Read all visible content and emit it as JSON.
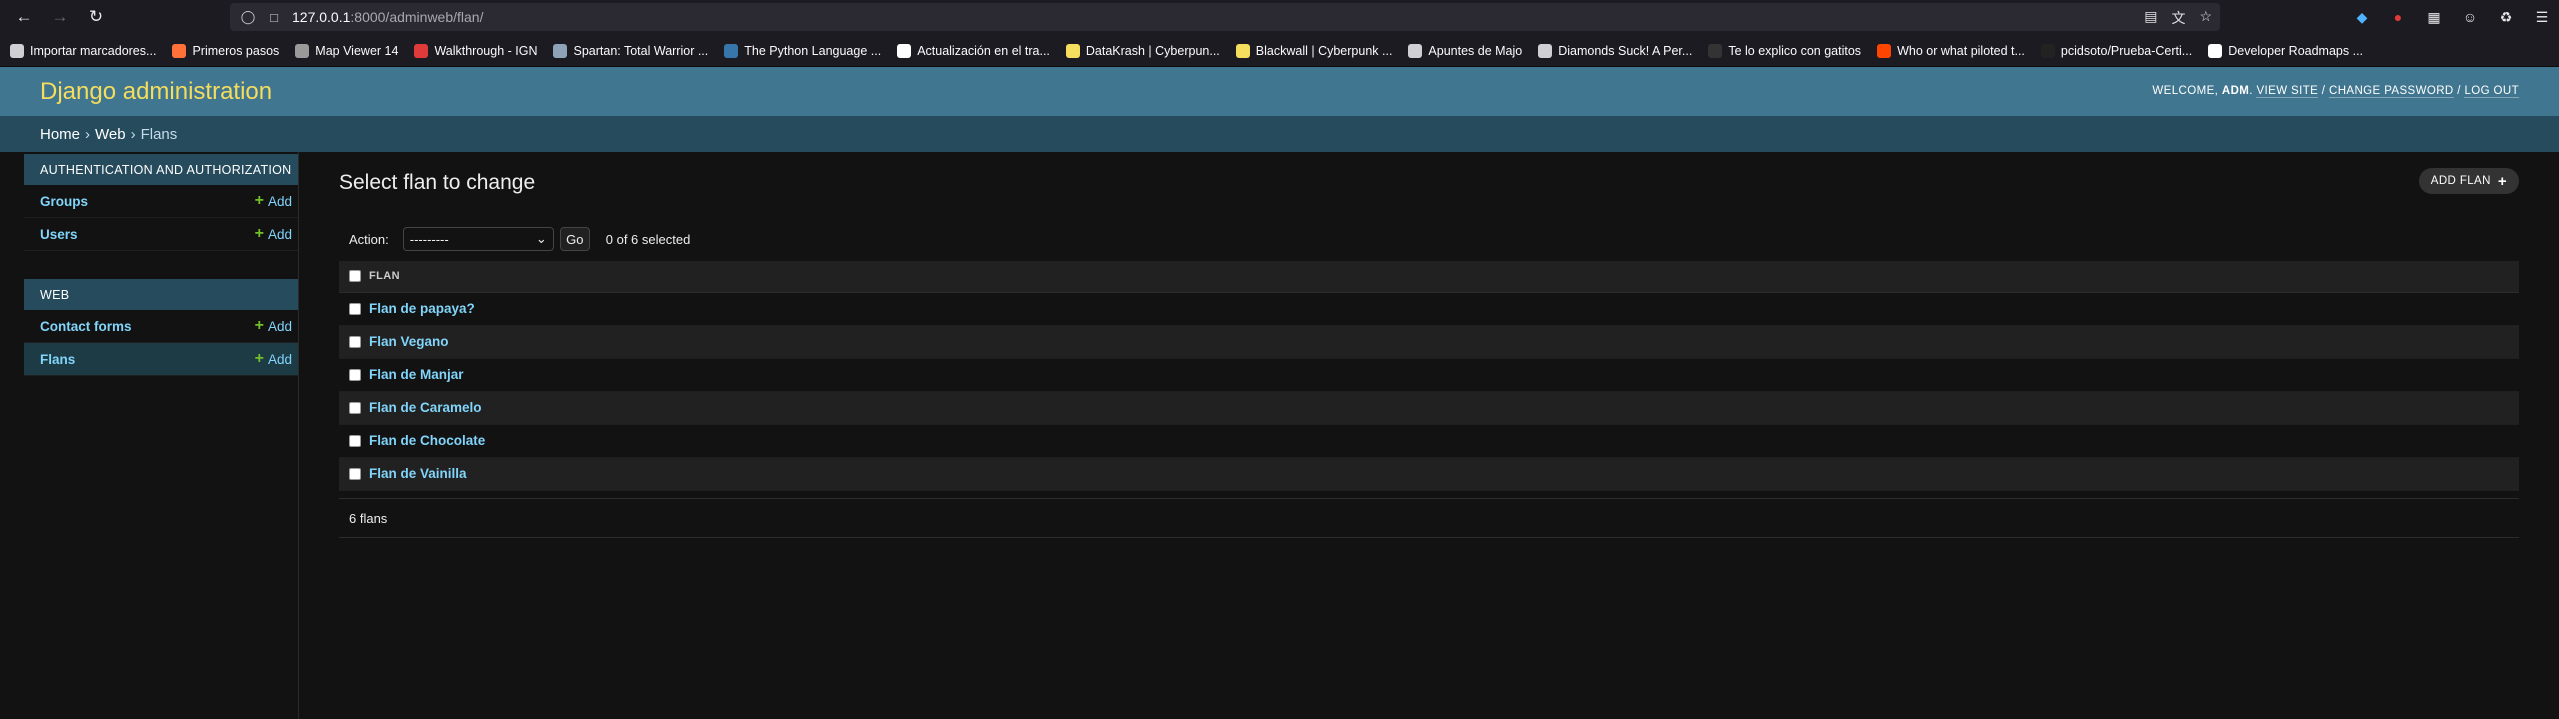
{
  "browser": {
    "url_host": "127.0.0.1",
    "url_rest": ":8000/adminweb/flan/",
    "bookmarks": [
      {
        "label": "Importar marcadores...",
        "color": "#cfcfd4"
      },
      {
        "label": "Primeros pasos",
        "color": "#ff7139"
      },
      {
        "label": "Map Viewer 14",
        "color": "#9a9a9a"
      },
      {
        "label": "Walkthrough - IGN",
        "color": "#e03b3b"
      },
      {
        "label": "Spartan: Total Warrior ...",
        "color": "#8fa3b8"
      },
      {
        "label": "The Python Language ...",
        "color": "#3776ab"
      },
      {
        "label": "Actualización en el tra...",
        "color": "#ffffff"
      },
      {
        "label": "DataKrash | Cyberpun...",
        "color": "#f5dd5d"
      },
      {
        "label": "Blackwall | Cyberpunk ...",
        "color": "#f5dd5d"
      },
      {
        "label": "Apuntes de Majo",
        "color": "#cfcfd4"
      },
      {
        "label": "Diamonds Suck! A Per...",
        "color": "#cfcfd4"
      },
      {
        "label": "Te lo explico con gatitos",
        "color": "#333333"
      },
      {
        "label": "Who or what piloted t...",
        "color": "#ff4500"
      },
      {
        "label": "pcidsoto/Prueba-Certi...",
        "color": "#222222"
      },
      {
        "label": "Developer Roadmaps ...",
        "color": "#ffffff"
      }
    ]
  },
  "header": {
    "branding": "Django administration",
    "welcome": "WELCOME,",
    "user": "ADM",
    "view_site": "VIEW SITE",
    "change_password": "CHANGE PASSWORD",
    "log_out": "LOG OUT"
  },
  "breadcrumbs": [
    "Home",
    "Web",
    "Flans"
  ],
  "sidebar": {
    "modules": [
      {
        "caption": "AUTHENTICATION AND AUTHORIZATION",
        "models": [
          {
            "name": "Groups",
            "add": "Add"
          },
          {
            "name": "Users",
            "add": "Add"
          }
        ]
      },
      {
        "caption": "WEB",
        "models": [
          {
            "name": "Contact forms",
            "add": "Add"
          },
          {
            "name": "Flans",
            "add": "Add"
          }
        ]
      }
    ]
  },
  "content": {
    "title": "Select flan to change",
    "add_button": "ADD FLAN",
    "action_label": "Action:",
    "action_selected": "---------",
    "go_label": "Go",
    "counter": "0 of 6 selected",
    "column_header": "FLAN",
    "rows": [
      "Flan de papaya?",
      "Flan Vegano",
      "Flan de Manjar",
      "Flan de Caramelo",
      "Flan de Chocolate",
      "Flan de Vainilla"
    ],
    "paginator": "6 flans"
  },
  "colors": {
    "header_bg": "#417690",
    "branding": "#f5dd5d",
    "breadcrumbs_bg": "#264b5d",
    "link": "#81d4fa",
    "add_plus": "#70bf2b"
  }
}
